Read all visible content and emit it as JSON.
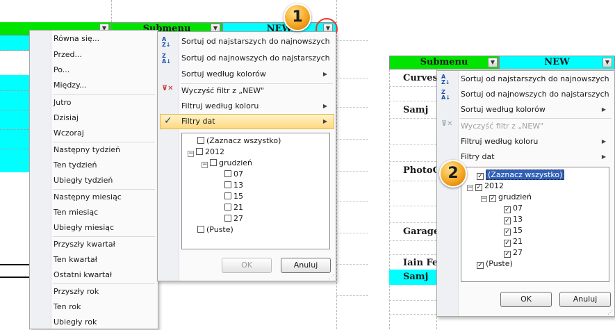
{
  "left_sheet": {
    "header_submenu": "Submenu",
    "header_new": "NEW",
    "filter_icon": "funnel-icon",
    "colors": {
      "green": "#00e400",
      "cyan": "#00ffff"
    }
  },
  "date_filters_menu": {
    "items": [
      "Równa się...",
      "Przed...",
      "Po...",
      "Między...",
      "Jutro",
      "Dzisiaj",
      "Wczoraj",
      "Następny tydzień",
      "Ten tydzień",
      "Ubiegły tydzień",
      "Następny miesiąc",
      "Ten miesiąc",
      "Ubiegły miesiąc",
      "Przyszły kwartał",
      "Ten kwartał",
      "Ostatni kwartał",
      "Przyszły rok",
      "Ten rok",
      "Ubiegły rok"
    ]
  },
  "filter_menu_1": {
    "sort_asc": "Sortuj od najstarszych do najnowszych",
    "sort_desc": "Sortuj od najnowszych do najstarszych",
    "sort_color": "Sortuj według kolorów",
    "clear_filter": "Wyczyść filtr z „NEW\"",
    "filter_color": "Filtruj według koloru",
    "date_filters": "Filtry dat",
    "tree": {
      "select_all": "(Zaznacz wszystko)",
      "year": "2012",
      "month": "grudzień",
      "days": [
        "07",
        "13",
        "15",
        "21",
        "27"
      ],
      "blanks": "(Puste)"
    },
    "ok": "OK",
    "cancel": "Anuluj"
  },
  "badges": {
    "one": "1",
    "two": "2"
  },
  "right_sheet": {
    "header_submenu": "Submenu",
    "header_new": "NEW",
    "cells": [
      "Curves",
      "Samj",
      "PhotoC",
      "Garage",
      "Iain Fe",
      "Samj"
    ]
  },
  "filter_menu_2": {
    "sort_asc": "Sortuj od najstarszych do najnowszych",
    "sort_desc": "Sortuj od najnowszych do najstarszych",
    "sort_color": "Sortuj według kolorów",
    "clear_filter": "Wyczyść filtr z „NEW\"",
    "filter_color": "Filtruj według koloru",
    "date_filters": "Filtry dat",
    "tree": {
      "select_all": "(Zaznacz wszystko)",
      "year": "2012",
      "month": "grudzień",
      "days": [
        "07",
        "13",
        "15",
        "21",
        "27"
      ],
      "blanks": "(Puste)"
    },
    "ok": "OK",
    "cancel": "Anuluj"
  }
}
